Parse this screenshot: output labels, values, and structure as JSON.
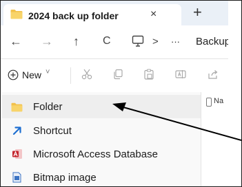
{
  "tab": {
    "title": "2024 back up folder",
    "close": "×",
    "new_tab": "+"
  },
  "nav": {
    "back": "←",
    "forward": "→",
    "up": "↑",
    "refresh": "C",
    "breadcrumb_sep": ">",
    "more": "···",
    "crumb": "Backup"
  },
  "toolbar": {
    "new_label": "New",
    "new_caret": "˅"
  },
  "details_header": "Na",
  "new_menu": {
    "items": [
      {
        "label": "Folder",
        "icon": "folder-icon"
      },
      {
        "label": "Shortcut",
        "icon": "shortcut-icon"
      },
      {
        "label": "Microsoft Access Database",
        "icon": "access-icon"
      },
      {
        "label": "Bitmap image",
        "icon": "bitmap-icon"
      }
    ]
  },
  "colors": {
    "folder": "#f2c14b",
    "shortcut": "#1e6fd1",
    "access": "#c4262e",
    "bitmap": "#3b73c4",
    "arrow": "#000000"
  }
}
